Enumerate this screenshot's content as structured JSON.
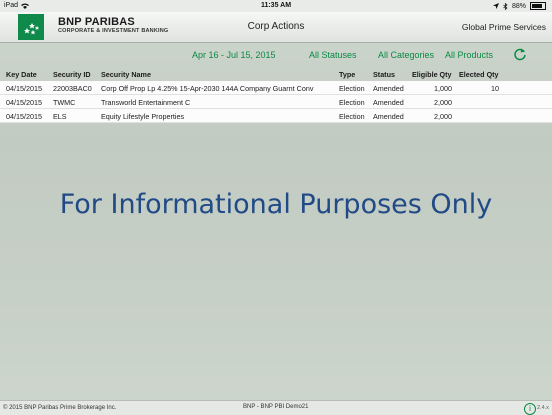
{
  "status_bar": {
    "carrier": "iPad",
    "time": "11:35 AM",
    "battery": "88%"
  },
  "header": {
    "brand_name": "BNP PARIBAS",
    "brand_sub": "CORPORATE & INVESTMENT BANKING",
    "title": "Corp Actions",
    "right_label": "Global Prime Services"
  },
  "filters": {
    "date_range": "Apr 16 - Jul 15, 2015",
    "statuses": "All Statuses",
    "categories": "All Categories",
    "products": "All Products"
  },
  "table": {
    "columns": [
      "Key Date",
      "Security ID",
      "Security Name",
      "Type",
      "Status",
      "Eligible Qty",
      "Elected Qty"
    ],
    "rows": [
      [
        "04/15/2015",
        "22003BAC0",
        "Corp Off Prop Lp 4.25% 15-Apr-2030 144A Company Guarnt Conv",
        "Election",
        "Amended",
        "1,000",
        "10"
      ],
      [
        "04/15/2015",
        "TWMC",
        "Transworld Entertainment C",
        "Election",
        "Amended",
        "2,000",
        ""
      ],
      [
        "04/15/2015",
        "ELS",
        "Equity Lifestyle Properties",
        "Election",
        "Amended",
        "2,000",
        ""
      ]
    ]
  },
  "watermark": "For Informational Purposes Only",
  "footer": {
    "copyright": "© 2015 BNP Paribas Prime Brokerage Inc.",
    "env": "BNP - BNP PBI Demo21",
    "version": "2.4.x"
  },
  "colors": {
    "accent": "#0b8a44",
    "watermark": "#214a86",
    "brand_green": "#0f8a4a"
  }
}
